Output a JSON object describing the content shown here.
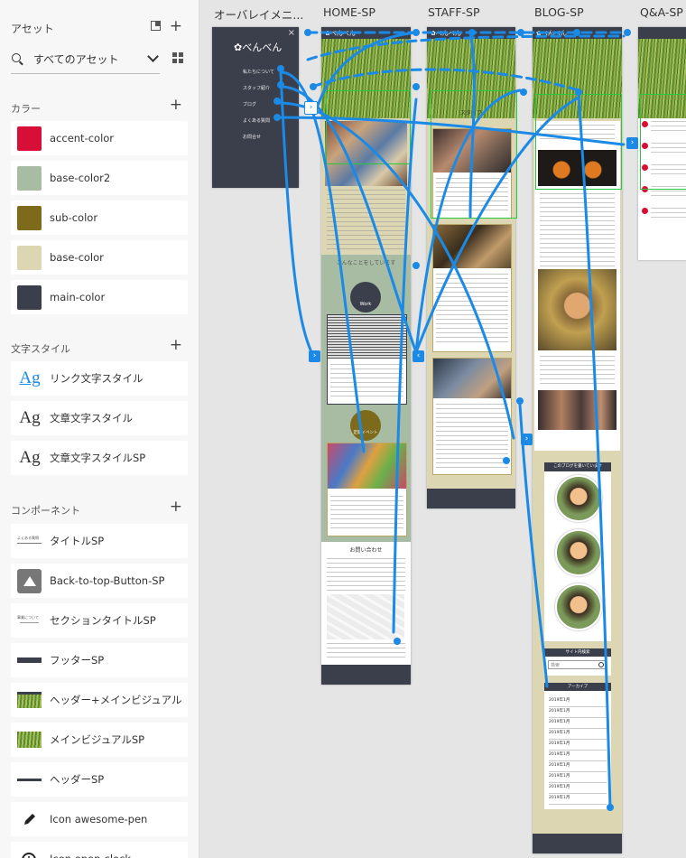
{
  "assets_panel": {
    "title": "アセット",
    "filter": "すべてのアセット",
    "colors_title": "カラー",
    "colors": [
      {
        "name": "accent-color",
        "hex": "#d70e36"
      },
      {
        "name": "base-color2",
        "hex": "#a8bca3"
      },
      {
        "name": "sub-color",
        "hex": "#7d6a1a"
      },
      {
        "name": "base-color",
        "hex": "#ddd6b2"
      },
      {
        "name": "main-color",
        "hex": "#3b3f4b"
      }
    ],
    "text_styles_title": "文字スタイル",
    "text_styles": [
      {
        "sample": "Ag",
        "name": "リンク文字スタイル",
        "color": "#1b8ae6"
      },
      {
        "sample": "Ag",
        "name": "文章文字スタイル",
        "color": "#333333"
      },
      {
        "sample": "Ag",
        "name": "文章文字スタイルSP",
        "color": "#333333"
      }
    ],
    "components_title": "コンポーネント",
    "components": [
      {
        "name": "タイトルSP",
        "icon": "title-thumb",
        "preview_text": "よくある質問"
      },
      {
        "name": "Back-to-top-Button-SP",
        "icon": "back-to-top-thumb"
      },
      {
        "name": "セクションタイトルSP",
        "icon": "section-title-thumb",
        "preview_text": "事業について"
      },
      {
        "name": "フッターSP",
        "icon": "footer-thumb"
      },
      {
        "name": "ヘッダー+メインビジュアル",
        "icon": "header-visual-thumb"
      },
      {
        "name": "メインビジュアルSP",
        "icon": "main-visual-thumb"
      },
      {
        "name": "ヘッダーSP",
        "icon": "header-thumb"
      },
      {
        "name": "Icon awesome-pen",
        "icon": "pen-icon"
      },
      {
        "name": "Icon open-clock",
        "icon": "clock-icon"
      }
    ]
  },
  "artboards": {
    "overlay_menu": {
      "title": "オーバレイメニ...",
      "logo": "✿べんべん",
      "items": [
        "私たちについて",
        "スタッフ紹介",
        "ブログ",
        "よくある質問",
        "お問合せ"
      ]
    },
    "home": {
      "title": "HOME-SP",
      "logo": "✿べんべん",
      "section1": "こんなことをしています",
      "badge_work": "Work",
      "badge_event": "定期イベント",
      "contact_title": "お問い合わせ"
    },
    "staff": {
      "title": "STAFF-SP",
      "logo": "✿べんべん",
      "section_title": "スタッフ"
    },
    "blog": {
      "title": "BLOG-SP",
      "logo": "✿べんべん",
      "profile_title": "このブログを書いています",
      "search_title": "サイト内検索",
      "search_placeholder": "検索",
      "archive_title": "アーカイブ",
      "archive_items": [
        "2019年1月",
        "2019年1月",
        "2019年1月",
        "2019年1月",
        "2019年1月",
        "2019年1月",
        "2019年1月",
        "2019年1月",
        "2019年1月",
        "2019年1月"
      ]
    },
    "qa": {
      "title": "Q&A-SP"
    }
  }
}
